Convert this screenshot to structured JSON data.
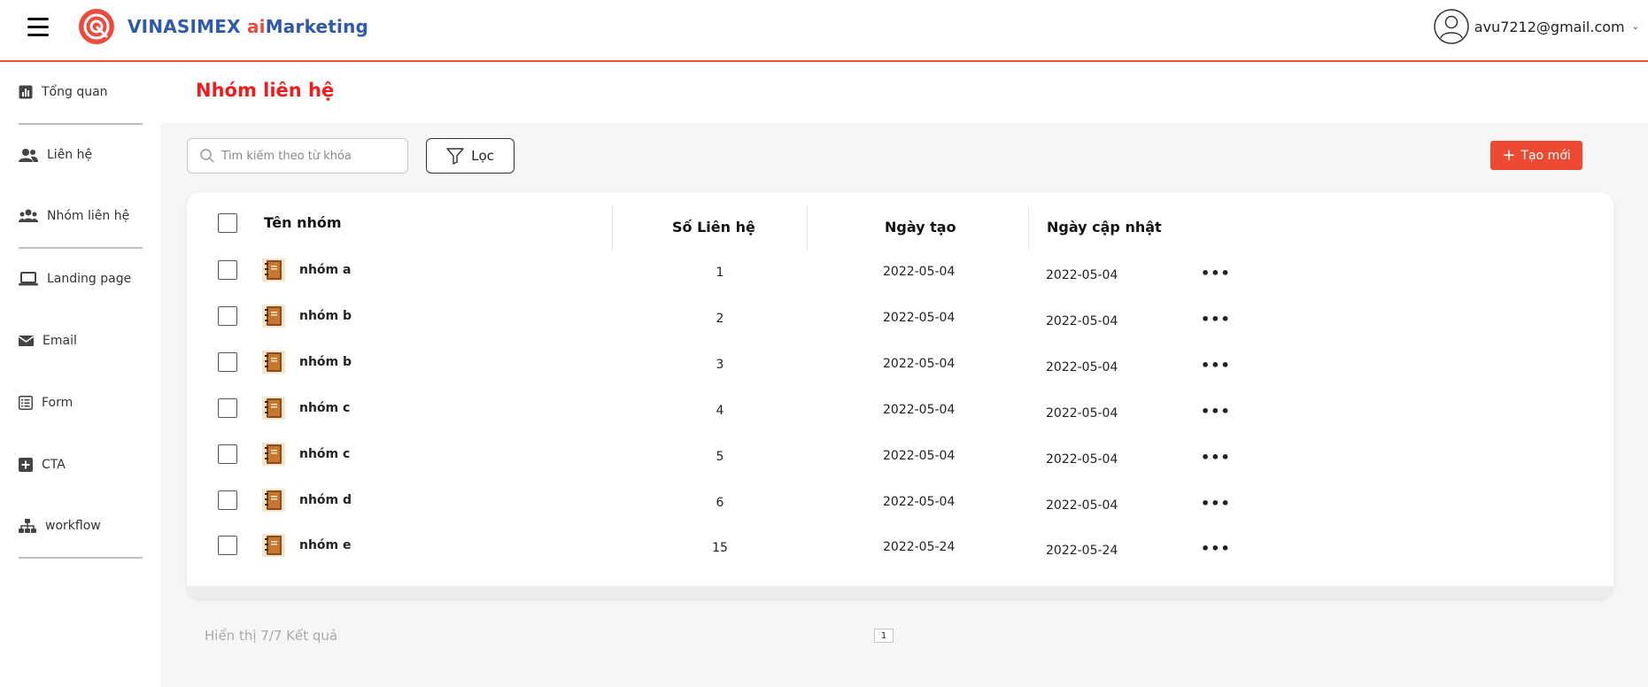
{
  "header": {
    "brand_main": "VINASIMEX ",
    "brand_ai": "ai",
    "brand_rest": "Marketing",
    "user_email": "avu7212@gmail.com"
  },
  "sidebar": {
    "items": [
      {
        "label": "Tổng quan",
        "icon": "bar-chart-icon"
      },
      {
        "label": "Liên hệ",
        "icon": "users-icon"
      },
      {
        "label": "Nhóm liên hệ",
        "icon": "user-group-icon"
      },
      {
        "label": "Landing page",
        "icon": "laptop-icon"
      },
      {
        "label": "Email",
        "icon": "envelope-icon"
      },
      {
        "label": "Form",
        "icon": "form-icon"
      },
      {
        "label": "CTA",
        "icon": "plus-square-icon"
      },
      {
        "label": "workflow",
        "icon": "sitemap-icon"
      }
    ]
  },
  "main": {
    "title": "Nhóm liên hệ",
    "search_placeholder": "Tìm kiếm theo từ khóa",
    "filter_label": "Lọc",
    "create_label": "Tạo mới",
    "accent_color": "#ee4a33"
  },
  "table": {
    "headers": {
      "name": "Tên nhóm",
      "contacts": "Số Liên hệ",
      "created": "Ngày tạo",
      "updated": "Ngày cập nhật"
    },
    "rows": [
      {
        "name": "nhóm a",
        "contacts": "1",
        "created": "2022-05-04",
        "updated": "2022-05-04"
      },
      {
        "name": "nhóm b",
        "contacts": "2",
        "created": "2022-05-04",
        "updated": "2022-05-04"
      },
      {
        "name": "nhóm b",
        "contacts": "3",
        "created": "2022-05-04",
        "updated": "2022-05-04"
      },
      {
        "name": "nhóm c",
        "contacts": "4",
        "created": "2022-05-04",
        "updated": "2022-05-04"
      },
      {
        "name": "nhóm c",
        "contacts": "5",
        "created": "2022-05-04",
        "updated": "2022-05-04"
      },
      {
        "name": "nhóm d",
        "contacts": "6",
        "created": "2022-05-04",
        "updated": "2022-05-04"
      },
      {
        "name": "nhóm e",
        "contacts": "15",
        "created": "2022-05-24",
        "updated": "2022-05-24"
      }
    ],
    "more_label": "•••"
  },
  "pagination": {
    "result_text": "Hiển thị 7/7 Kết quả",
    "current_page": "1"
  }
}
